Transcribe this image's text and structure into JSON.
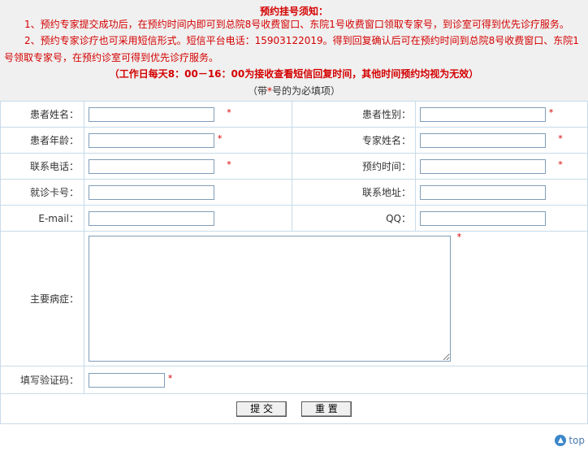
{
  "notice": {
    "title": "预约挂号须知：",
    "p1": "1、预约专家提交成功后，在预约时间内即可到总院8号收费窗口、东院1号收费窗口领取专家号，到诊室可得到优先诊疗服务。",
    "p2": "2、预约专家诊疗也可采用短信形式。短信平台电话：15903122019。得到回复确认后可在预约时间到总院8号收费窗口、东院1号领取专家号，在预约诊室可得到优先诊疗服务。",
    "hours": "（工作日每天8：00－16：00为接收查看短信回复时间，其他时间预约均视为无效）",
    "required_prefix": "（带",
    "required_star": "*",
    "required_suffix": "号的为必填项）"
  },
  "form": {
    "patient_name_label": "患者姓名：",
    "patient_gender_label": "患者性别：",
    "patient_age_label": "患者年龄：",
    "expert_name_label": "专家姓名：",
    "phone_label": "联系电话：",
    "appointment_time_label": "预约时间：",
    "card_number_label": "就诊卡号：",
    "address_label": "联系地址：",
    "email_label": "E-mail：",
    "qq_label": "QQ：",
    "symptoms_label": "主要病症：",
    "captcha_label": "填写验证码：",
    "star": "*"
  },
  "buttons": {
    "submit": "提 交",
    "reset": "重 置"
  },
  "footer": {
    "top_label": "top"
  }
}
